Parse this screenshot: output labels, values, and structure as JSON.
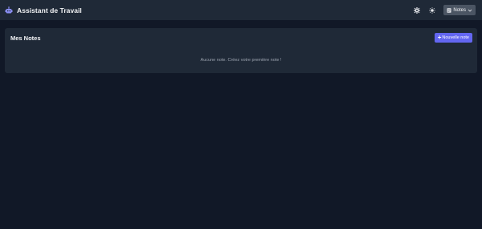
{
  "header": {
    "app_title": "Assistant de Travail",
    "brand_icon": "robot-icon",
    "settings_icon": "gear-icon",
    "theme_icon": "sun-icon",
    "notes_dropdown_label": "Notes"
  },
  "notes_panel": {
    "title": "Mes Notes",
    "new_note_label": "Nouvelle note",
    "empty_message": "Aucune note. Créez votre première note !"
  },
  "colors": {
    "background": "#111827",
    "surface": "#1f2937",
    "accent": "#6366f1"
  }
}
